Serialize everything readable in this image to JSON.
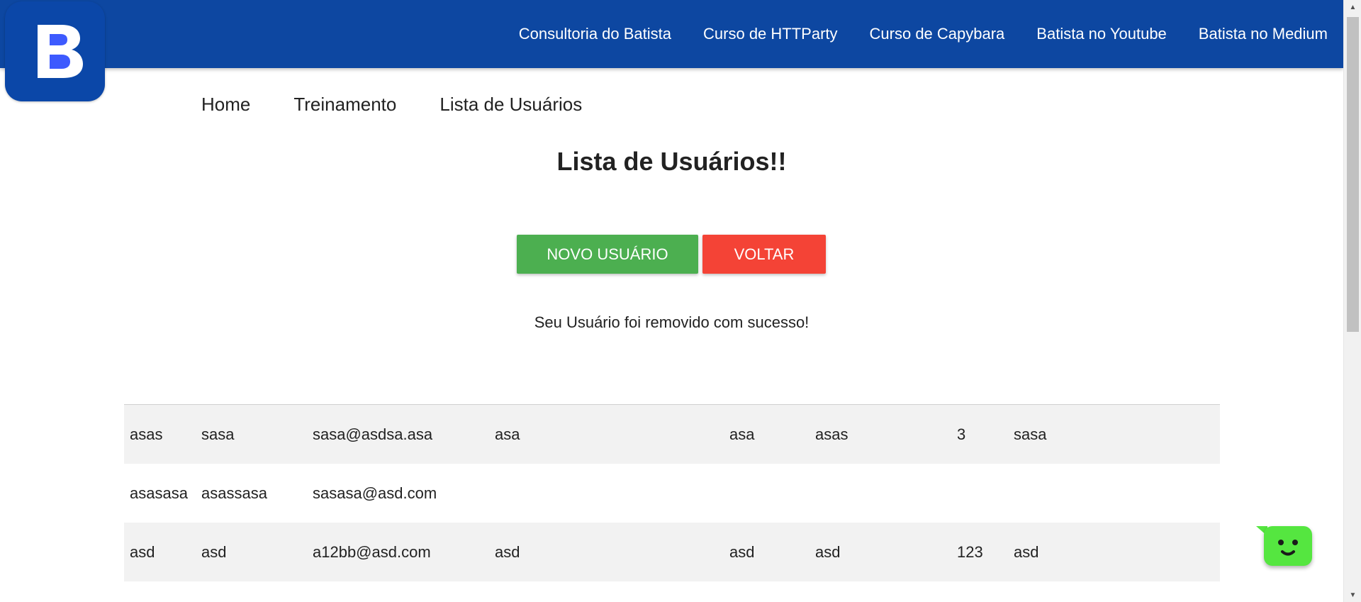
{
  "logo": {
    "letter": "B"
  },
  "top_nav": {
    "links": [
      "Consultoria do Batista",
      "Curso de HTTParty",
      "Curso de Capybara",
      "Batista no Youtube",
      "Batista no Medium"
    ]
  },
  "sub_nav": {
    "links": [
      "Home",
      "Treinamento",
      "Lista de Usuários"
    ]
  },
  "main": {
    "title": "Lista de Usuários!!",
    "new_user_label": "NOVO USUÁRIO",
    "back_label": "VOLTAR",
    "flash_message": "Seu Usuário foi removido com sucesso!"
  },
  "users": [
    [
      "asas",
      "sasa",
      "sasa@asdsa.asa",
      "asa",
      "asa",
      "asas",
      "3",
      "sasa"
    ],
    [
      "asasasa",
      "asassasa",
      "sasasa@asd.com",
      "",
      "",
      "",
      "",
      ""
    ],
    [
      "asd",
      "asd",
      "a12bb@asd.com",
      "asd",
      "asd",
      "asd",
      "123",
      "asd"
    ]
  ],
  "colors": {
    "topbar": "#0d47a1",
    "logo_bg": "#0b47a8",
    "logo_letter": "#ffffff",
    "logo_accent": "#3d5afe",
    "new_button": "#4caf50",
    "back_button": "#f44336",
    "row_striped": "#f2f2f2",
    "chat_widget": "#55e640"
  },
  "icons": {
    "scroll_up": "arrow-up-icon",
    "scroll_down": "arrow-down-icon",
    "chat": "chat-smiley-icon"
  }
}
